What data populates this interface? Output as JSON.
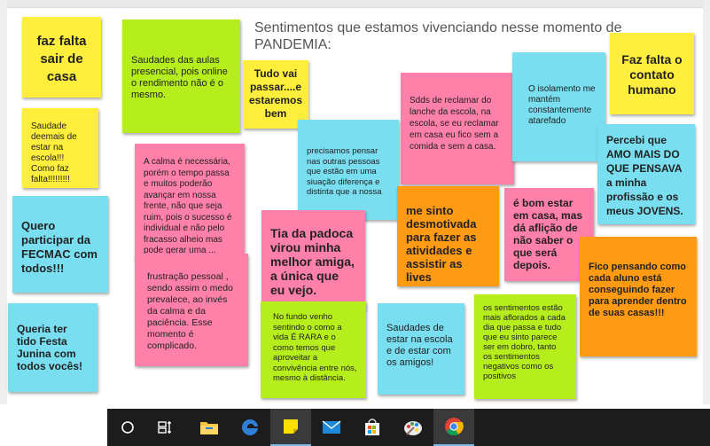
{
  "board": {
    "title": "Sentimentos que estamos vivenciando nesse momento de PANDEMIA:",
    "notes": [
      {
        "text": "faz falta sair de casa",
        "color": "yellow"
      },
      {
        "text": "Saudades das aulas presencial, pois online o rendimento não é o mesmo.",
        "color": "green"
      },
      {
        "text": "Tudo vai passar....e estaremos bem",
        "color": "yellow"
      },
      {
        "text": "Saudade deemais de estar na escola!!! Como faz falta!!!!!!!!!",
        "color": "yellow"
      },
      {
        "text": "A calma é necessária, porém o tempo passa e muitos poderão avançar em nossa frente, não que seja ruim, pois o sucesso é individual e não pelo fracasso alheio mas pode gerar uma ...",
        "color": "pink"
      },
      {
        "text": "precisamos pensar nas outras pessoas que estão em uma siuação diferença e distinta que a nossa",
        "color": "cyan"
      },
      {
        "text": "Sdds de reclamar do lanche da escola, na escola, se eu reclamar em casa eu fico sem a comida e sem a casa.",
        "color": "pink"
      },
      {
        "text": "O isolamento me mantém constantemente atarefado",
        "color": "cyan"
      },
      {
        "text": "Faz falta o contato humano",
        "color": "yellow"
      },
      {
        "text": "Percebi que AMO MAIS DO QUE PENSAVA a minha profissão e os meus JOVENS.",
        "color": "cyan"
      },
      {
        "text": "Quero participar da FECMAC com todos!!!",
        "color": "cyan"
      },
      {
        "text": "Tia da padoca virou minha melhor amiga, a única que eu vejo.",
        "color": "pink"
      },
      {
        "text": "me sinto desmotivada para fazer as atividades e assistir as lives",
        "color": "orange"
      },
      {
        "text": "é bom estar em casa, mas dá aflição de não saber o que será depois.",
        "color": "pink"
      },
      {
        "text": "frustração pessoal , sendo  assim o medo prevalece, ao invés da calma e da paciência. Esse momento é complicado.",
        "color": "pink"
      },
      {
        "text": "Fico pensando como cada aluno está conseguindo fazer para aprender dentro de suas casas!!!",
        "color": "orange"
      },
      {
        "text": "Queria ter tido Festa Junina com todos vocês!",
        "color": "cyan"
      },
      {
        "text": "No fundo venho sentindo o como a vida É RARA e o como temos que aproveitar a convivência entre nós, mesmo à distância.",
        "color": "green"
      },
      {
        "text": "Saudades de estar na escola e de estar com os amigos!",
        "color": "cyan"
      },
      {
        "text": "os sentimentos estão mais aflorados a cada dia que passa e tudo que eu sinto parece ser em dobro, tanto os sentimentos negativos como os positivos",
        "color": "green"
      }
    ]
  },
  "taskbar": {
    "icons": [
      "task-view-circle-icon",
      "timeline-icon",
      "file-explorer-icon",
      "edge-browser-icon",
      "sticky-notes-icon",
      "mail-icon",
      "store-icon",
      "paint-icon",
      "chrome-icon"
    ],
    "accent": "#76b9ed"
  }
}
